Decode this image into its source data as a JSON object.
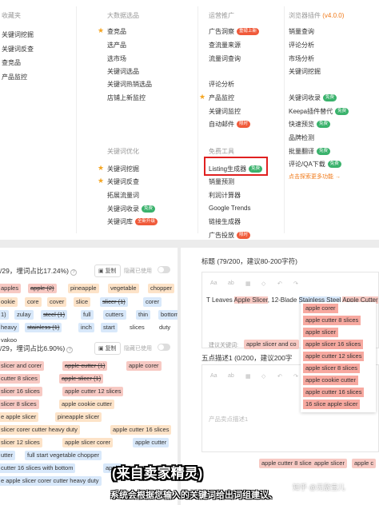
{
  "menu": {
    "favorites": {
      "title": "收藏夹",
      "items": [
        "关键词挖掘",
        "关键词反查",
        "查竞品",
        "产品监控"
      ]
    },
    "big_data": {
      "title": "大数据选品",
      "items": [
        {
          "label": "查竞品",
          "star": true
        },
        {
          "label": "选产品"
        },
        {
          "label": "选市场"
        },
        {
          "label": "关键词选品"
        },
        {
          "label": "关键词热销选品"
        },
        {
          "label": "店铺上新监控"
        }
      ],
      "kw_title": "关键词优化",
      "kw_items": [
        {
          "label": "关键词挖掘",
          "star": true
        },
        {
          "label": "关键词反查",
          "star": true
        },
        {
          "label": "拓展流量词"
        },
        {
          "label": "关键词收录",
          "badge": "免费"
        },
        {
          "label": "关键词库",
          "badge": "全新升级"
        }
      ]
    },
    "ops": {
      "title": "运营推广",
      "items": [
        {
          "label": "广告洞察",
          "badge": "重磅上新"
        },
        {
          "label": "查流量来源"
        },
        {
          "label": "流量词查询"
        },
        {
          "label": "评论分析"
        },
        {
          "label": "产品监控",
          "star": true
        },
        {
          "label": "关键词监控"
        },
        {
          "label": "自动邮件",
          "badge": "限时"
        }
      ],
      "free_title": "免费工具",
      "free_items": [
        {
          "label": "Listing生成器",
          "badge": "免费"
        },
        {
          "label": "销量预测"
        },
        {
          "label": "利润计算器"
        },
        {
          "label": "Google Trends"
        },
        {
          "label": "链接生成器"
        },
        {
          "label": "广告投放",
          "badge": "限时"
        }
      ]
    },
    "plugin": {
      "title": "浏览器插件",
      "version": "(v4.0.0)",
      "items": [
        {
          "label": "销量查询"
        },
        {
          "label": "评论分析"
        },
        {
          "label": "市场分析"
        },
        {
          "label": "关键词挖掘"
        },
        {
          "label": "关键词收录",
          "badge": "免费"
        },
        {
          "label": "Keepa插件替代",
          "badge": "免费"
        },
        {
          "label": "快速预览",
          "badge": "免费"
        },
        {
          "label": "品牌检测"
        },
        {
          "label": "批量翻译",
          "badge": "免费"
        },
        {
          "label": "评论/QA下载",
          "badge": "免费"
        }
      ],
      "more_link": "点击探索更多功能 →"
    }
  },
  "left_panel": {
    "section1": {
      "title": "/29，埋词占比17.24%)",
      "copy": "复制",
      "hide": "隐藏已使用"
    },
    "section2": {
      "title": "/29，埋词占比6.90%)",
      "copy": "复制",
      "hide": "隐藏已使用"
    },
    "kw1": [
      {
        "t": "apples",
        "c": "r"
      },
      {
        "t": "apple (2)",
        "c": "r",
        "s": true
      },
      {
        "t": "pineapple",
        "c": "o"
      },
      {
        "t": "vegetable",
        "c": "o"
      },
      {
        "t": "chopper",
        "c": "o"
      },
      {
        "t": "ookie",
        "c": "o"
      },
      {
        "t": "core",
        "c": "o"
      },
      {
        "t": "cover",
        "c": "o"
      },
      {
        "t": "slice",
        "c": "o"
      },
      {
        "t": "slicer (1)",
        "c": "b",
        "s": true
      },
      {
        "t": "corer",
        "c": "b"
      },
      {
        "t": "1)",
        "c": "b"
      },
      {
        "t": "zulay",
        "c": "b"
      },
      {
        "t": "steel (1)",
        "c": "b",
        "s": true
      },
      {
        "t": "full",
        "c": "b"
      },
      {
        "t": "cutters",
        "c": "b"
      },
      {
        "t": "thin",
        "c": "b"
      },
      {
        "t": "bottom",
        "c": "b"
      },
      {
        "t": "heavy",
        "c": "b"
      },
      {
        "t": "stainless (1)",
        "c": "b",
        "s": true
      },
      {
        "t": "inch",
        "c": "b"
      },
      {
        "t": "start",
        "c": "b"
      },
      {
        "t": "slices",
        "c": "t"
      },
      {
        "t": "duty",
        "c": "t"
      },
      {
        "t": "vakoo",
        "c": "t"
      }
    ],
    "kw2": [
      {
        "t": "slicer and corer",
        "c": "r"
      },
      {
        "t": "apple cutter (1)",
        "c": "r",
        "s": true
      },
      {
        "t": "apple corer",
        "c": "r"
      },
      {
        "t": "cutter 8 slices",
        "c": "r"
      },
      {
        "t": "apple slicer (1)",
        "c": "r",
        "s": true
      },
      {
        "t": "slicer 16 slices",
        "c": "r"
      },
      {
        "t": "apple cutter 12 slices",
        "c": "r"
      },
      {
        "t": "slicer 8 slices",
        "c": "r"
      },
      {
        "t": "apple cookie cutter",
        "c": "o"
      },
      {
        "t": "e apple slicer",
        "c": "o"
      },
      {
        "t": "pineapple slicer",
        "c": "o"
      },
      {
        "t": "slicer corer cutter heavy duty",
        "c": "o"
      },
      {
        "t": "apple cutter 16 slices",
        "c": "o"
      },
      {
        "t": "slicer 12 slices",
        "c": "o"
      },
      {
        "t": "apple slicer corer",
        "c": "o"
      },
      {
        "t": "apple cutter",
        "c": "b"
      },
      {
        "t": "utter",
        "c": "b"
      },
      {
        "t": "full start vegetable chopper",
        "c": "b"
      },
      {
        "t": "cutter 16 slices with bottom",
        "c": "b"
      },
      {
        "t": "apple",
        "c": "b"
      },
      {
        "t": "e apple slicer corer cutter heavy duty",
        "c": "b"
      }
    ]
  },
  "right_panel": {
    "title_label": "标题 (79/200，建议80-200字符)",
    "toolbar": [
      "Aa",
      "ab",
      "▦",
      "◇",
      "↶",
      "↷"
    ],
    "title_parts": [
      {
        "t": "T Leaves ",
        "c": "t"
      },
      {
        "t": "Apple Slicer",
        "c": "r"
      },
      {
        "t": ", 12-Blade ",
        "c": "t"
      },
      {
        "t": "Stainless Steel",
        "c": "b"
      },
      {
        "t": " ",
        "c": "t"
      },
      {
        "t": "Apple Cutter",
        "c": "r"
      }
    ],
    "suggest_label": "建议关键词:",
    "suggest_chip": "apple slicer and co",
    "suggestions": [
      "apple corer",
      "apple cutter 8 slices",
      "apple slicer",
      "apple slicer 16 slices",
      "apple cutter 12 slices",
      "apple slicer 8 slices",
      "apple cookie cutter",
      "apple cutter 16 slices",
      "16 slice apple slicer"
    ],
    "bullet_label": "五点描述1 (0/200，建议200字",
    "bullet_placeholder": "产品卖点描述1",
    "bottom_chips": [
      "apple cutter 8 slices",
      "apple slicer",
      "apple c"
    ]
  },
  "captions": {
    "headline": "(来自卖家精灵)",
    "subline": "系统会根据您输入的关键词给出词组建议、",
    "watermark": "知乎 @无敌宝儿"
  },
  "colors": {
    "red": "#f05a3a",
    "green": "#3ab26c",
    "orange": "#f07a1a",
    "kw_red": "#f7c9c3",
    "kw_orange": "#fde3c8",
    "kw_blue": "#d8e8fa",
    "highlight": "#e02020"
  }
}
